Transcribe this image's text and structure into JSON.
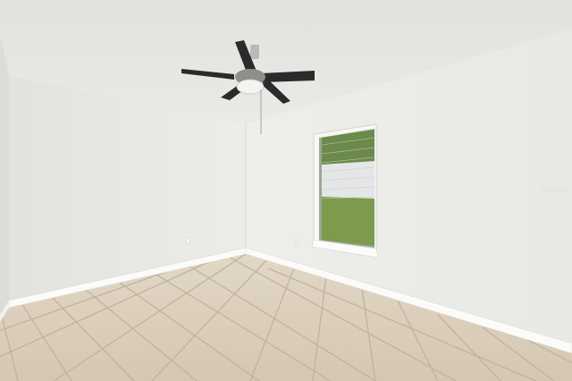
{
  "scene": {
    "room": "empty bedroom",
    "elements": [
      "ceiling-fan",
      "window-with-blinds",
      "tile-floor",
      "baseboards",
      "textured-ceiling",
      "electrical-outlets"
    ],
    "colors": {
      "ceiling": "#ecebe8",
      "left_wall": "#e9e9e6",
      "right_wall": "#ededea",
      "floor": "#d9ccb9",
      "grout": "#c2b29d",
      "baseboard": "#ffffff",
      "fan_blade": "#2b2b2b",
      "fan_light": "#f4f4f2",
      "window_frame": "#f7f7f5",
      "foliage": "#6c8a4a",
      "lawn": "#7d9a4d",
      "fence": "#e4e6e7"
    }
  }
}
